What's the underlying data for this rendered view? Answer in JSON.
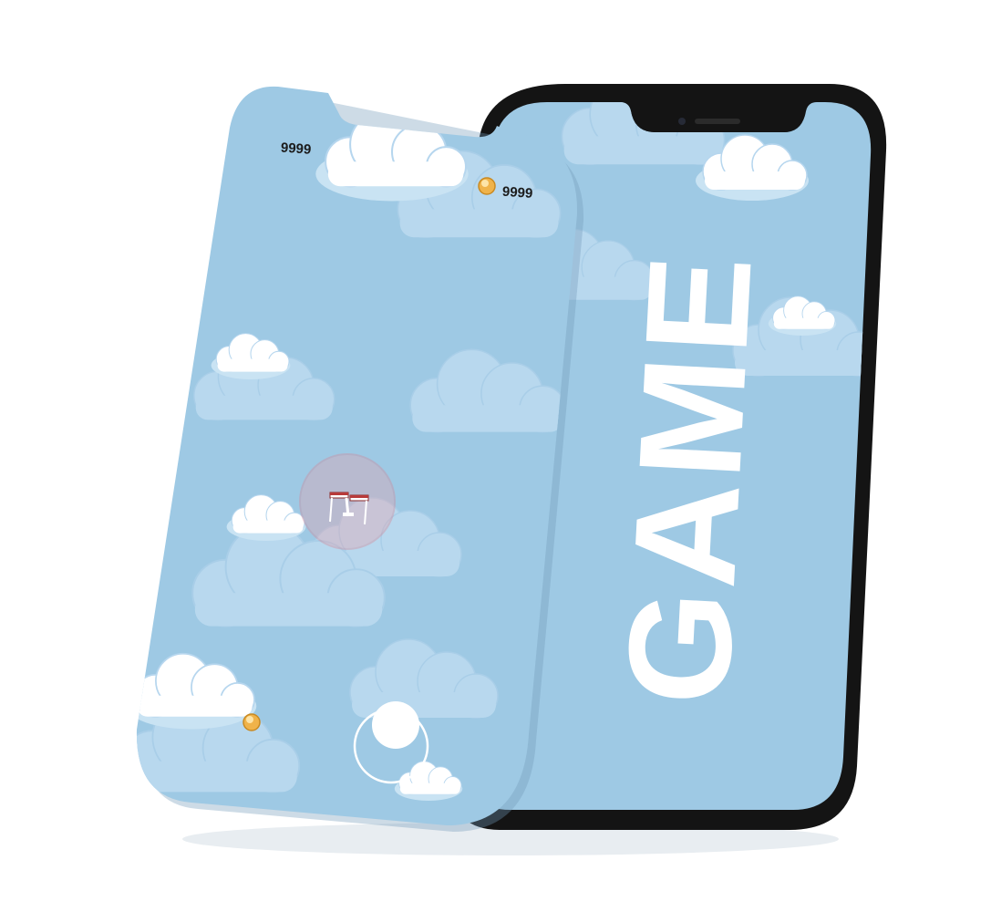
{
  "game": {
    "score_left": "9999",
    "score_right": "9999",
    "title_word": "GAME"
  },
  "icons": {
    "coin": "gold-coin-icon",
    "player": "plane-in-shield-bubble",
    "joystick": "virtual-joystick"
  },
  "colors": {
    "sky": "#9ec9e4",
    "cloud_white": "#ffffff",
    "cloud_shadow": "#c9e3f3",
    "phone_frame": "#141414",
    "coin": "#f0b34a",
    "shield": "#e07a86"
  }
}
